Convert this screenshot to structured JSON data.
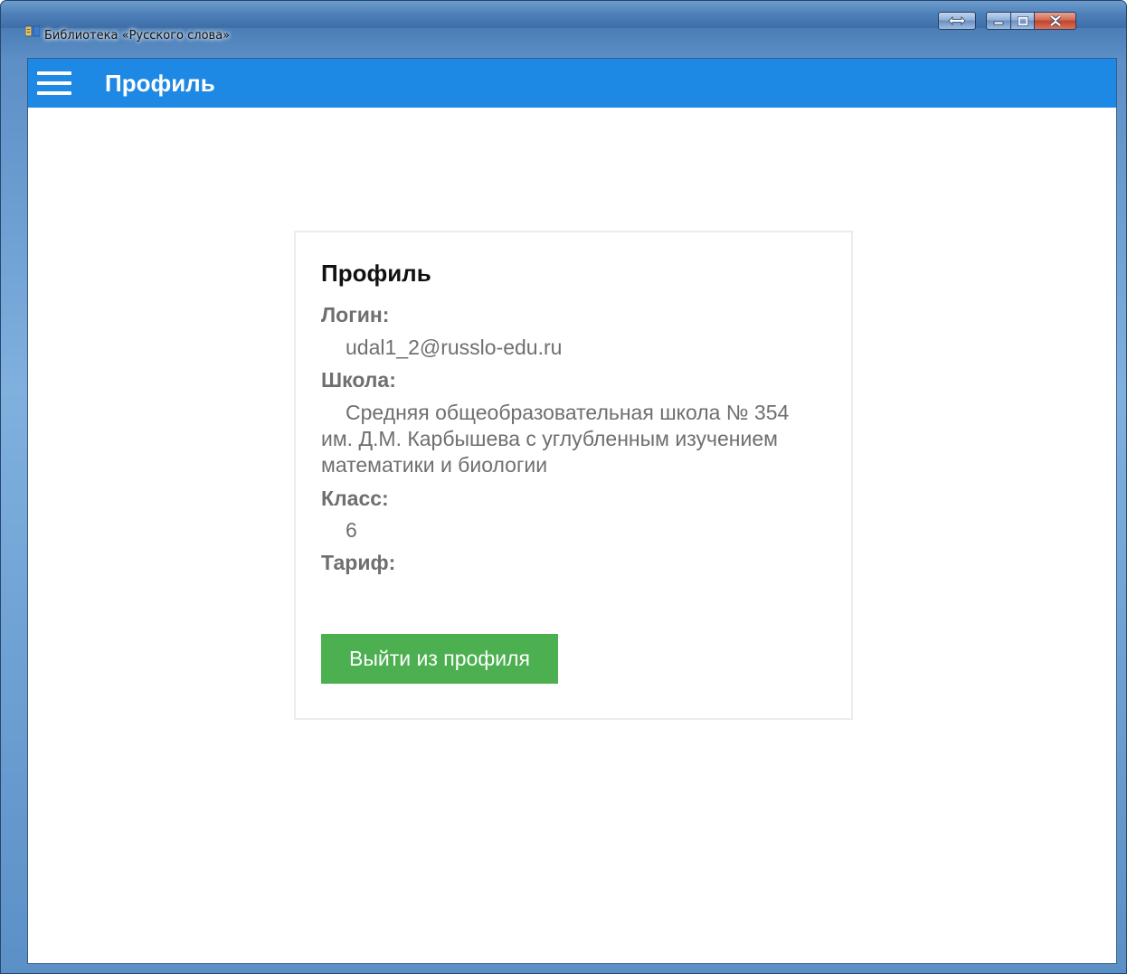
{
  "window": {
    "title": "Библиотека «Русского слова»"
  },
  "appbar": {
    "title": "Профиль"
  },
  "profile": {
    "heading": "Профиль",
    "fields": [
      {
        "label": "Логин:",
        "value": "udal1_2@russlo-edu.ru"
      },
      {
        "label": "Школа:",
        "value": "Средняя общеобразовательная школа № 354 им. Д.М. Карбышева с углубленным изучением математики и биологии"
      },
      {
        "label": "Класс:",
        "value": "6"
      },
      {
        "label": "Тариф:",
        "value": ""
      }
    ],
    "logout_label": "Выйти из профиля"
  },
  "colors": {
    "appbar": "#1e88e5",
    "logout_button": "#4caf50",
    "label_text": "#6f6f6f"
  },
  "icons": {
    "menu": "hamburger-menu-icon",
    "app": "book-icon"
  }
}
